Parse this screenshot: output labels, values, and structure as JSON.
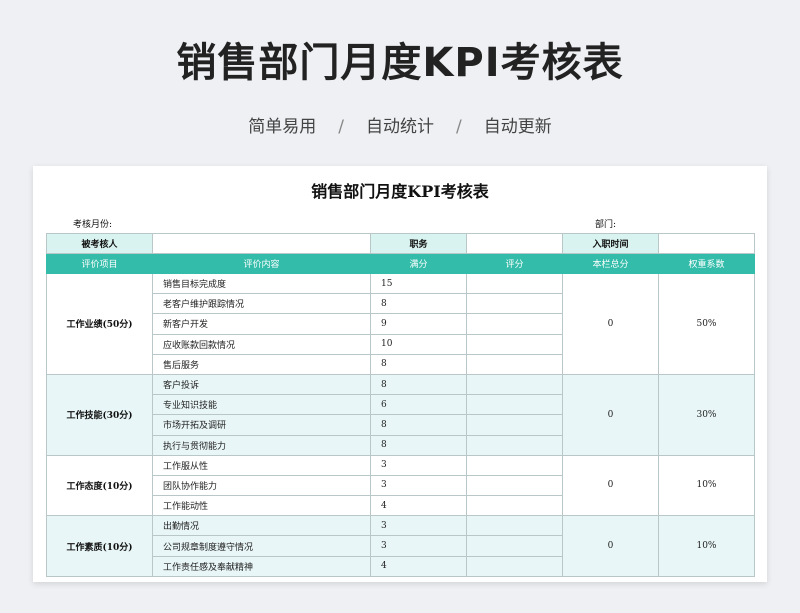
{
  "banner": {
    "title": "销售部门月度KPI考核表",
    "tags": [
      "简单易用",
      "自动统计",
      "自动更新"
    ],
    "separator": "/"
  },
  "sheet": {
    "title": "销售部门月度KPI考核表",
    "month_label": "考核月份:",
    "dept_label": "部门:",
    "info": {
      "examinee_label": "被考核人",
      "position_label": "职务",
      "join_date_label": "入职时间"
    },
    "headers": [
      "评价项目",
      "评价内容",
      "满分",
      "评分",
      "本栏总分",
      "权重系数"
    ],
    "groups": [
      {
        "category": "工作业绩(50分)",
        "subtotal": "0",
        "weight": "50%",
        "items": [
          {
            "content": "销售目标完成度",
            "full": "15"
          },
          {
            "content": "老客户维护跟踪情况",
            "full": "8"
          },
          {
            "content": "新客户开发",
            "full": "9"
          },
          {
            "content": "应收账款回款情况",
            "full": "10"
          },
          {
            "content": "售后服务",
            "full": "8"
          }
        ]
      },
      {
        "category": "工作技能(30分)",
        "subtotal": "0",
        "weight": "30%",
        "items": [
          {
            "content": "客户投诉",
            "full": "8"
          },
          {
            "content": "专业知识技能",
            "full": "6"
          },
          {
            "content": "市场开拓及调研",
            "full": "8"
          },
          {
            "content": "执行与贯彻能力",
            "full": "8"
          }
        ]
      },
      {
        "category": "工作态度(10分)",
        "subtotal": "0",
        "weight": "10%",
        "items": [
          {
            "content": "工作服从性",
            "full": "3"
          },
          {
            "content": "团队协作能力",
            "full": "3"
          },
          {
            "content": "工作能动性",
            "full": "4"
          }
        ]
      },
      {
        "category": "工作素质(10分)",
        "subtotal": "0",
        "weight": "10%",
        "items": [
          {
            "content": "出勤情况",
            "full": "3"
          },
          {
            "content": "公司规章制度遵守情况",
            "full": "3"
          },
          {
            "content": "工作责任感及奉献精神",
            "full": "4"
          }
        ]
      }
    ]
  }
}
